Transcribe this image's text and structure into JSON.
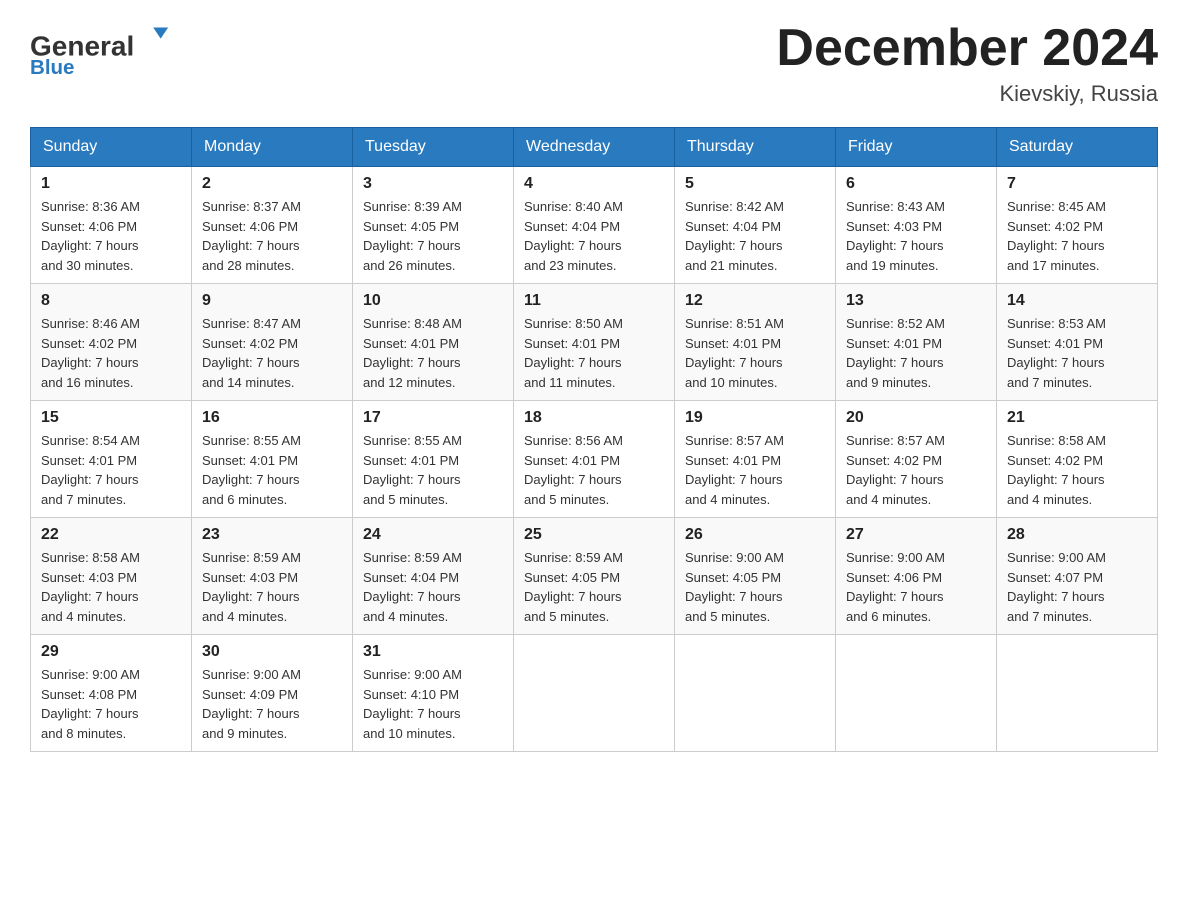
{
  "header": {
    "logo_general": "General",
    "logo_blue": "Blue",
    "title": "December 2024",
    "subtitle": "Kievskiy, Russia"
  },
  "weekdays": [
    "Sunday",
    "Monday",
    "Tuesday",
    "Wednesday",
    "Thursday",
    "Friday",
    "Saturday"
  ],
  "weeks": [
    [
      {
        "day": "1",
        "sunrise": "8:36 AM",
        "sunset": "4:06 PM",
        "daylight": "7 hours and 30 minutes."
      },
      {
        "day": "2",
        "sunrise": "8:37 AM",
        "sunset": "4:06 PM",
        "daylight": "7 hours and 28 minutes."
      },
      {
        "day": "3",
        "sunrise": "8:39 AM",
        "sunset": "4:05 PM",
        "daylight": "7 hours and 26 minutes."
      },
      {
        "day": "4",
        "sunrise": "8:40 AM",
        "sunset": "4:04 PM",
        "daylight": "7 hours and 23 minutes."
      },
      {
        "day": "5",
        "sunrise": "8:42 AM",
        "sunset": "4:04 PM",
        "daylight": "7 hours and 21 minutes."
      },
      {
        "day": "6",
        "sunrise": "8:43 AM",
        "sunset": "4:03 PM",
        "daylight": "7 hours and 19 minutes."
      },
      {
        "day": "7",
        "sunrise": "8:45 AM",
        "sunset": "4:02 PM",
        "daylight": "7 hours and 17 minutes."
      }
    ],
    [
      {
        "day": "8",
        "sunrise": "8:46 AM",
        "sunset": "4:02 PM",
        "daylight": "7 hours and 16 minutes."
      },
      {
        "day": "9",
        "sunrise": "8:47 AM",
        "sunset": "4:02 PM",
        "daylight": "7 hours and 14 minutes."
      },
      {
        "day": "10",
        "sunrise": "8:48 AM",
        "sunset": "4:01 PM",
        "daylight": "7 hours and 12 minutes."
      },
      {
        "day": "11",
        "sunrise": "8:50 AM",
        "sunset": "4:01 PM",
        "daylight": "7 hours and 11 minutes."
      },
      {
        "day": "12",
        "sunrise": "8:51 AM",
        "sunset": "4:01 PM",
        "daylight": "7 hours and 10 minutes."
      },
      {
        "day": "13",
        "sunrise": "8:52 AM",
        "sunset": "4:01 PM",
        "daylight": "7 hours and 9 minutes."
      },
      {
        "day": "14",
        "sunrise": "8:53 AM",
        "sunset": "4:01 PM",
        "daylight": "7 hours and 7 minutes."
      }
    ],
    [
      {
        "day": "15",
        "sunrise": "8:54 AM",
        "sunset": "4:01 PM",
        "daylight": "7 hours and 7 minutes."
      },
      {
        "day": "16",
        "sunrise": "8:55 AM",
        "sunset": "4:01 PM",
        "daylight": "7 hours and 6 minutes."
      },
      {
        "day": "17",
        "sunrise": "8:55 AM",
        "sunset": "4:01 PM",
        "daylight": "7 hours and 5 minutes."
      },
      {
        "day": "18",
        "sunrise": "8:56 AM",
        "sunset": "4:01 PM",
        "daylight": "7 hours and 5 minutes."
      },
      {
        "day": "19",
        "sunrise": "8:57 AM",
        "sunset": "4:01 PM",
        "daylight": "7 hours and 4 minutes."
      },
      {
        "day": "20",
        "sunrise": "8:57 AM",
        "sunset": "4:02 PM",
        "daylight": "7 hours and 4 minutes."
      },
      {
        "day": "21",
        "sunrise": "8:58 AM",
        "sunset": "4:02 PM",
        "daylight": "7 hours and 4 minutes."
      }
    ],
    [
      {
        "day": "22",
        "sunrise": "8:58 AM",
        "sunset": "4:03 PM",
        "daylight": "7 hours and 4 minutes."
      },
      {
        "day": "23",
        "sunrise": "8:59 AM",
        "sunset": "4:03 PM",
        "daylight": "7 hours and 4 minutes."
      },
      {
        "day": "24",
        "sunrise": "8:59 AM",
        "sunset": "4:04 PM",
        "daylight": "7 hours and 4 minutes."
      },
      {
        "day": "25",
        "sunrise": "8:59 AM",
        "sunset": "4:05 PM",
        "daylight": "7 hours and 5 minutes."
      },
      {
        "day": "26",
        "sunrise": "9:00 AM",
        "sunset": "4:05 PM",
        "daylight": "7 hours and 5 minutes."
      },
      {
        "day": "27",
        "sunrise": "9:00 AM",
        "sunset": "4:06 PM",
        "daylight": "7 hours and 6 minutes."
      },
      {
        "day": "28",
        "sunrise": "9:00 AM",
        "sunset": "4:07 PM",
        "daylight": "7 hours and 7 minutes."
      }
    ],
    [
      {
        "day": "29",
        "sunrise": "9:00 AM",
        "sunset": "4:08 PM",
        "daylight": "7 hours and 8 minutes."
      },
      {
        "day": "30",
        "sunrise": "9:00 AM",
        "sunset": "4:09 PM",
        "daylight": "7 hours and 9 minutes."
      },
      {
        "day": "31",
        "sunrise": "9:00 AM",
        "sunset": "4:10 PM",
        "daylight": "7 hours and 10 minutes."
      },
      null,
      null,
      null,
      null
    ]
  ],
  "labels": {
    "sunrise": "Sunrise:",
    "sunset": "Sunset:",
    "daylight": "Daylight:"
  }
}
